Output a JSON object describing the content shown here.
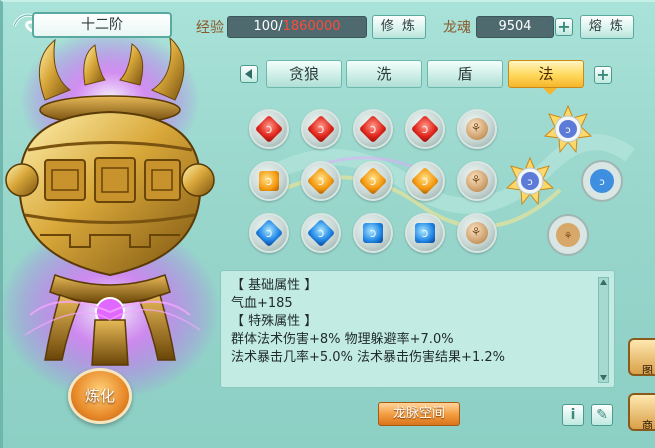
{
  "header": {
    "rank": "十二阶",
    "exp_label": "经验",
    "exp_current": "100/",
    "exp_required": "1860000",
    "cultivate_btn": "修 炼",
    "soul_label": "龙魂",
    "soul_value": "9504",
    "smelt_btn": "熔 炼"
  },
  "tabs": [
    {
      "label": "贪狼",
      "active": false
    },
    {
      "label": "洗",
      "active": false
    },
    {
      "label": "盾",
      "active": false
    },
    {
      "label": "法",
      "active": true
    }
  ],
  "gem_grid": [
    [
      "red",
      "red",
      "red",
      "red",
      "bronze"
    ],
    [
      "orange-square",
      "orange",
      "orange",
      "orange",
      "bronze"
    ],
    [
      "blue",
      "blue",
      "blue-square",
      "blue-square",
      "bronze"
    ]
  ],
  "info": {
    "basic_header": "【 基础属性 】",
    "basic_line": "气血+185",
    "special_header": "【 特殊属性 】",
    "special_line1": "群体法术伤害+8%  物理躲避率+7.0%",
    "special_line2": "法术暴击几率+5.0%  法术暴击伤害结果+1.2%"
  },
  "buttons": {
    "dragon_space": "龙脉空间",
    "refine": "炼化",
    "info_icon": "i"
  },
  "side_tabs": [
    "图",
    "商"
  ],
  "colors": {
    "accent_gold": "#f5b52c",
    "exp_red": "#ff4a3a",
    "panel_teal": "#9ad7cd"
  }
}
